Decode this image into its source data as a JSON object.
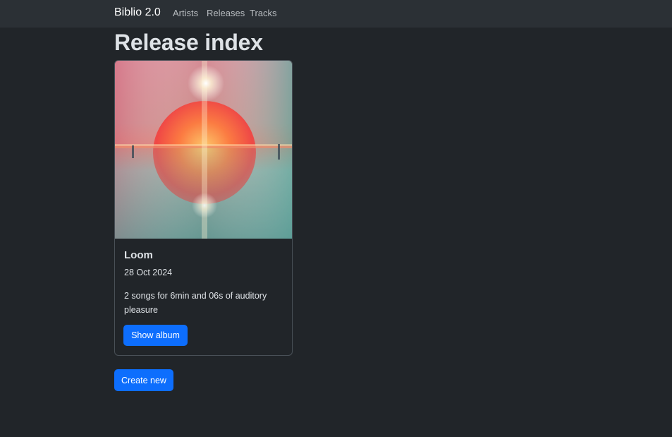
{
  "navbar": {
    "brand": "Biblio 2.0",
    "links": [
      "Artists",
      "Releases",
      "Tracks"
    ]
  },
  "page": {
    "title": "Release index"
  },
  "releases": [
    {
      "title": "Loom",
      "date": "28 Oct 2024",
      "description": "2 songs for 6min and 06s of auditory pleasure",
      "button_label": "Show album",
      "cover_icon": "album-cover-image"
    }
  ],
  "actions": {
    "create_label": "Create new"
  },
  "colors": {
    "background": "#212529",
    "navbar": "#2b3035",
    "primary": "#0d6efd",
    "text": "#dee2e6"
  }
}
